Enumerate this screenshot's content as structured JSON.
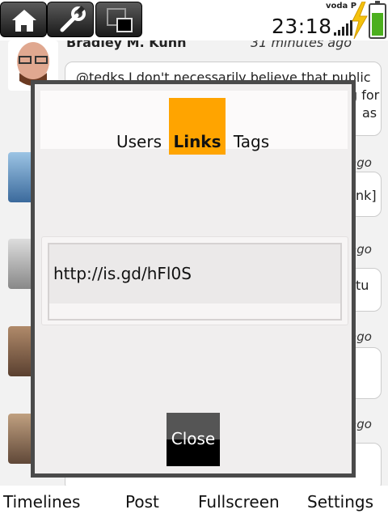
{
  "status": {
    "clock": "23:18",
    "carrier": "voda P"
  },
  "toolbar": {
    "icons": [
      "home-icon",
      "wrench-icon",
      "window-icon"
    ]
  },
  "timeline": {
    "first_author": "Bradley M. Kuhn",
    "first_time": "31 minutes ago",
    "first_text_line1": "@tedks I don't necessarily believe that public",
    "first_text_line2": "g for",
    "first_text_line3": "as",
    "ago_label": "ago",
    "frag_2": "nk]",
    "frag_3": "tu"
  },
  "dialog": {
    "tabs": [
      "Users",
      "Links",
      "Tags"
    ],
    "active_tab": "Links",
    "link_url": "http://is.gd/hFl0S",
    "close_label": "Close",
    "accent": "#ffa400"
  },
  "bottomnav": {
    "items": [
      "Timelines",
      "Post",
      "Fullscreen",
      "Settings"
    ]
  }
}
